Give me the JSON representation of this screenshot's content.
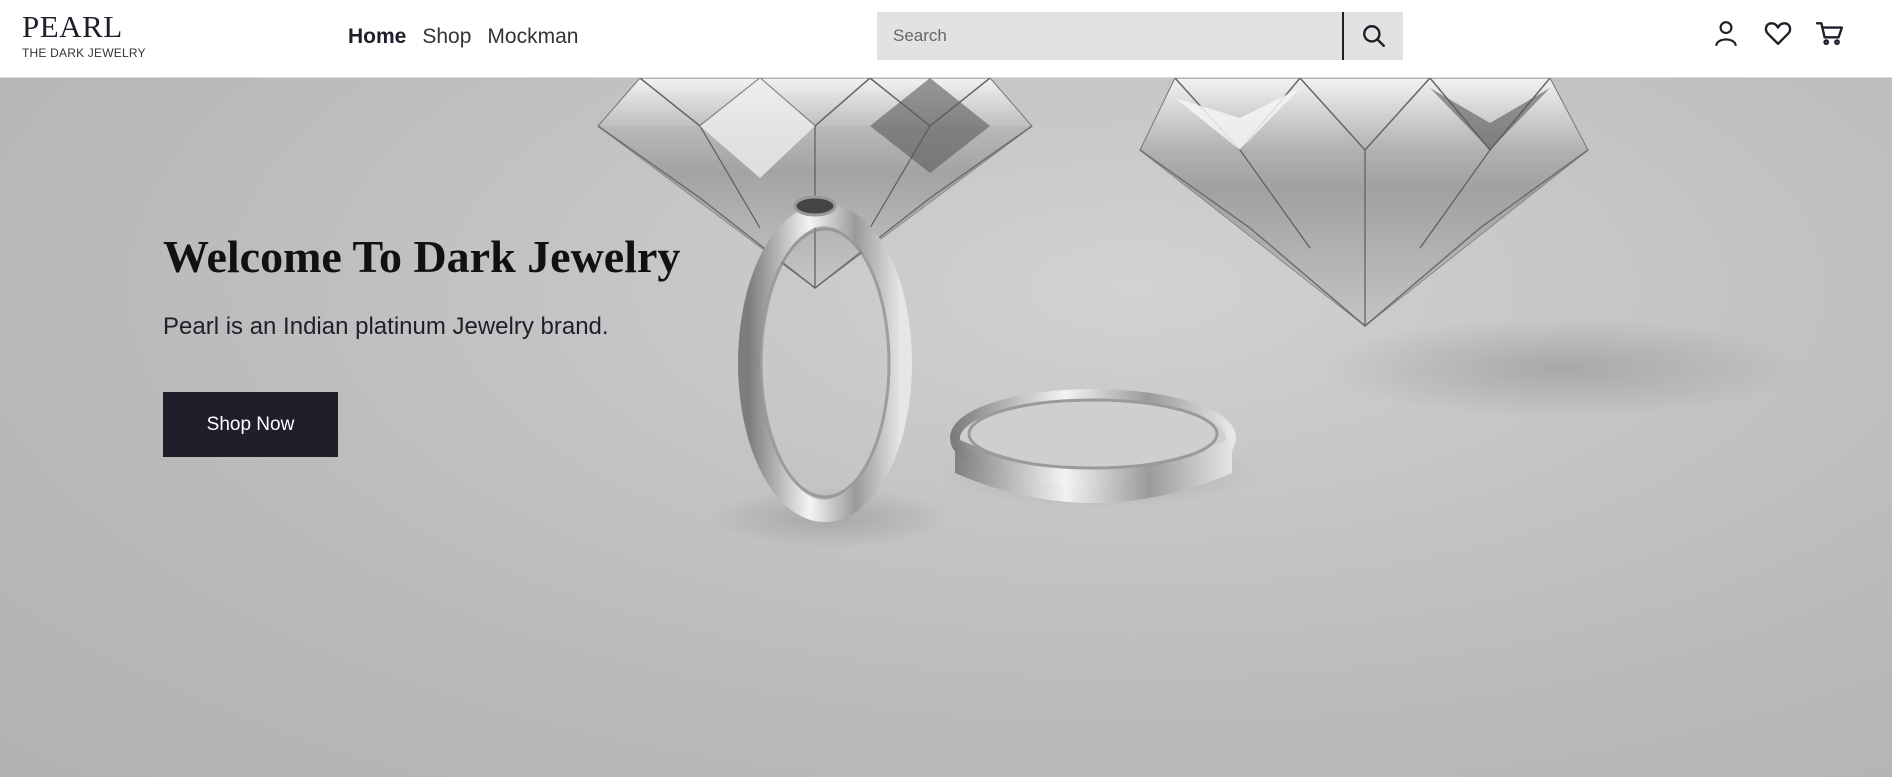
{
  "header": {
    "logo_title": "PEARL",
    "logo_subtitle": "THE DARK JEWELRY",
    "nav": [
      "Home",
      "Shop",
      "Mockman"
    ],
    "search_placeholder": "Search",
    "icons": [
      "search-icon",
      "user-icon",
      "heart-icon",
      "cart-icon"
    ]
  },
  "hero": {
    "title": "Welcome To Dark Jewelry",
    "subtitle": "Pearl is an Indian platinum Jewelry brand.",
    "cta_label": "Shop Now"
  },
  "colors": {
    "brand_dark": "#1f1e2a",
    "search_bg": "#e2e2e2",
    "hero_bg": "#bdbdbd"
  }
}
